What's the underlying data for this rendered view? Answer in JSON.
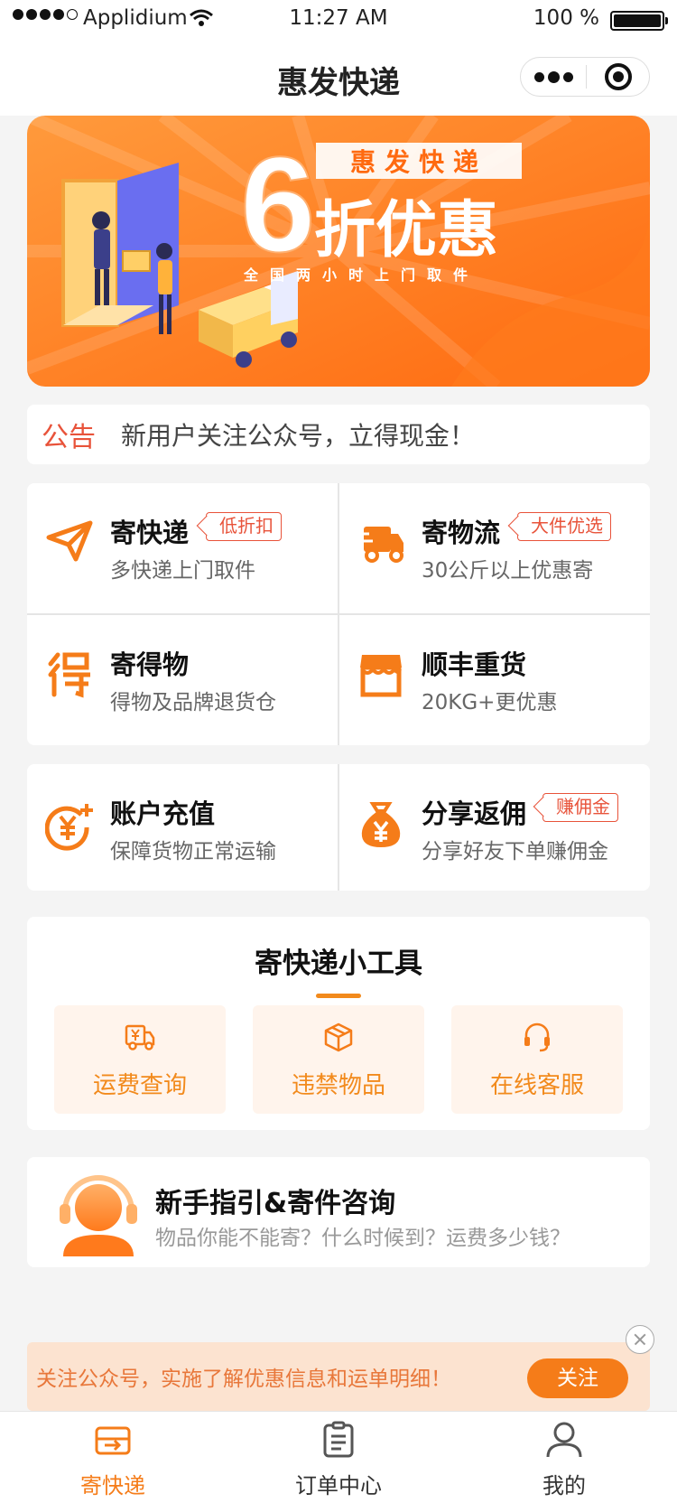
{
  "status_bar": {
    "carrier": "Applidium",
    "time": "11:27 AM",
    "battery": "100 %"
  },
  "navbar": {
    "title": "惠发快递"
  },
  "banner": {
    "brand": "惠发快递",
    "big_digit": "6",
    "headline": "折优惠",
    "subline": "全国两小时上门取件"
  },
  "notice": {
    "tag": "公告",
    "text": "新用户关注公众号，立得现金！"
  },
  "services": [
    {
      "title": "寄快递",
      "subtitle": "多快递上门取件",
      "badge": "低折扣",
      "icon": "paper-plane-icon"
    },
    {
      "title": "寄物流",
      "subtitle": "30公斤以上优惠寄",
      "badge": "大件优选",
      "icon": "truck-icon"
    },
    {
      "title": "寄得物",
      "subtitle": "得物及品牌退货仓",
      "badge": "",
      "icon": "dewu-icon"
    },
    {
      "title": "顺丰重货",
      "subtitle": "20KG+更优惠",
      "badge": "",
      "icon": "store-icon"
    }
  ],
  "account_services": [
    {
      "title": "账户充值",
      "subtitle": "保障货物正常运输",
      "badge": "",
      "icon": "yen-plus-icon"
    },
    {
      "title": "分享返佣",
      "subtitle": "分享好友下单赚佣金",
      "badge": "赚佣金",
      "icon": "money-bag-icon"
    }
  ],
  "tools": {
    "title": "寄快递小工具",
    "items": [
      {
        "label": "运费查询",
        "icon": "freight-truck-icon"
      },
      {
        "label": "违禁物品",
        "icon": "box-icon"
      },
      {
        "label": "在线客服",
        "icon": "headset-icon"
      }
    ]
  },
  "guide": {
    "title": "新手指引&寄件咨询",
    "subtitle": "物品你能不能寄？什么时候到？运费多少钱？"
  },
  "follow_bar": {
    "text": "关注公众号，实施了解优惠信息和运单明细！",
    "button": "关注"
  },
  "tabbar": {
    "items": [
      {
        "label": "寄快递",
        "active": true
      },
      {
        "label": "订单中心",
        "active": false
      },
      {
        "label": "我的",
        "active": false
      }
    ]
  },
  "colors": {
    "accent": "#f57c19",
    "notice_red": "#e8533a",
    "background": "#f4f4f4"
  }
}
